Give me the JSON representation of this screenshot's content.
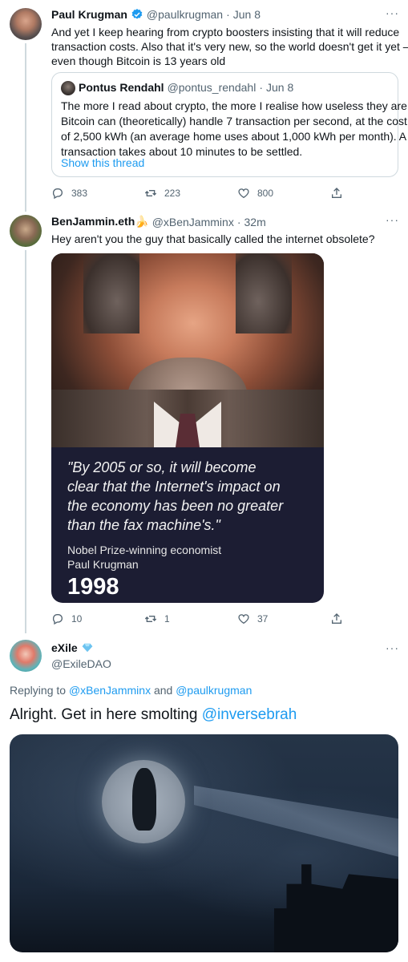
{
  "tweet1": {
    "author_name": "Paul Krugman",
    "handle": "@paulkrugman",
    "date": "Jun 8",
    "more": "···",
    "text_lines": [
      "And yet I keep hearing from crypto boosters insisting that it will reduce",
      "transaction costs. Also that it's very new, so the world doesn't get it yet —",
      "even though Bitcoin is 13 years old"
    ],
    "quote": {
      "author_name": "Pontus Rendahl",
      "handle": "@pontus_rendahl",
      "date": "Jun 8",
      "text_lines": [
        "The more I read about crypto, the more I realise how useless they are.",
        "Bitcoin can (theoretically) handle 7 transaction per second, at the cost",
        "of 2,500 kWh (an average home uses about 1,000 kWh per month). A",
        "transaction takes about 10 minutes to be settled."
      ],
      "show_thread": "Show this thread"
    },
    "replies": "383",
    "retweets": "223",
    "likes": "800"
  },
  "tweet2": {
    "author_name": "BenJammin.eth🍌",
    "handle": "@xBenJamminx",
    "date": "32m",
    "more": "···",
    "text": "Hey aren't you the guy that basically called the internet obsolete?",
    "image": {
      "quote_lines": [
        "\"By 2005 or so, it will become",
        "clear that the Internet's impact on",
        "the economy has been no greater",
        "than the fax machine's.\""
      ],
      "attribution_lines": [
        "Nobel Prize-winning economist",
        "Paul Krugman"
      ],
      "year": "1998"
    },
    "replies": "10",
    "retweets": "1",
    "likes": "37"
  },
  "tweet3": {
    "author_name": "eXile",
    "handle": "@ExileDAO",
    "more": "···",
    "replying_to_prefix": "Replying to",
    "replying_to_user1": "@xBenJamminx",
    "replying_to_and": "and",
    "replying_to_user2": "@paulkrugman",
    "text": "Alright. Get in here smolting",
    "mention": "@inversebrah"
  },
  "colors": {
    "accent": "#1d9bf0",
    "verified": "#1d9bf0",
    "secondary_text": "#536471",
    "border": "#cfd9de"
  },
  "icons": [
    "verified-badge-icon",
    "reply-icon",
    "retweet-icon",
    "like-icon",
    "share-icon",
    "more-icon",
    "diamond-icon"
  ]
}
